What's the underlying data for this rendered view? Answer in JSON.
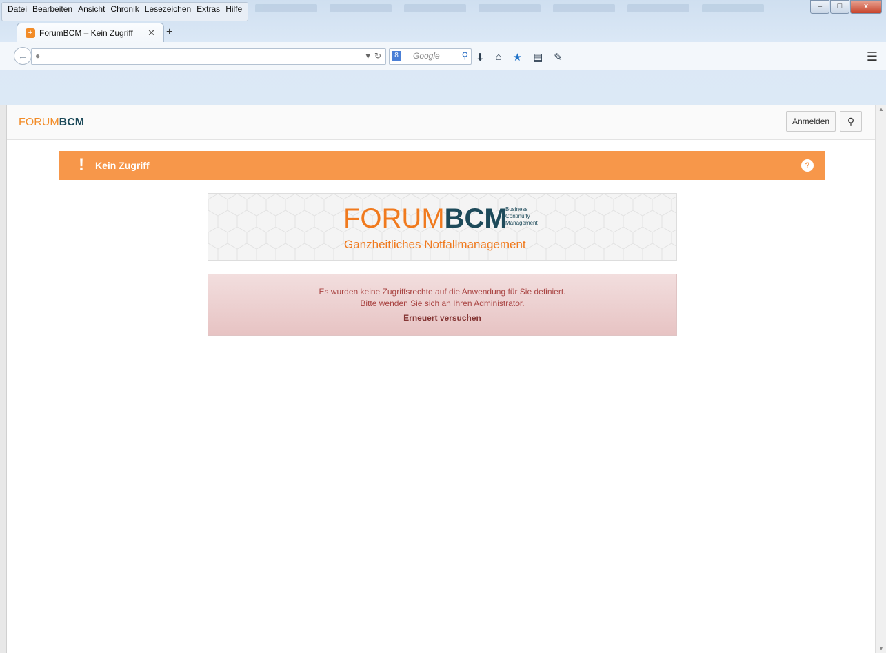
{
  "browser": {
    "menu": [
      "Datei",
      "Bearbeiten",
      "Ansicht",
      "Chronik",
      "Lesezeichen",
      "Extras",
      "Hilfe"
    ],
    "tab_title": "ForumBCM – Kein Zugriff",
    "search_placeholder": "Google",
    "window_controls": {
      "close": "x"
    }
  },
  "app": {
    "brand_light": "FORUM",
    "brand_bold": "BCM",
    "login_label": "Anmelden"
  },
  "alert": {
    "title": "Kein Zugriff",
    "icon": "!"
  },
  "logo": {
    "main_light": "FORUM",
    "main_bold": "BCM",
    "sub_lines": [
      "Business",
      "Continuity",
      "Management"
    ],
    "tagline": "Ganzheitliches Notfallmanagement"
  },
  "error": {
    "line1": "Es wurden keine Zugriffsrechte auf die Anwendung für Sie definiert.",
    "line2": "Bitte wenden Sie sich an Ihren Administrator.",
    "retry": "Erneuert versuchen"
  },
  "colors": {
    "accent_orange": "#f7974a",
    "brand_dark": "#1d4a5a",
    "error_text": "#a94442"
  }
}
